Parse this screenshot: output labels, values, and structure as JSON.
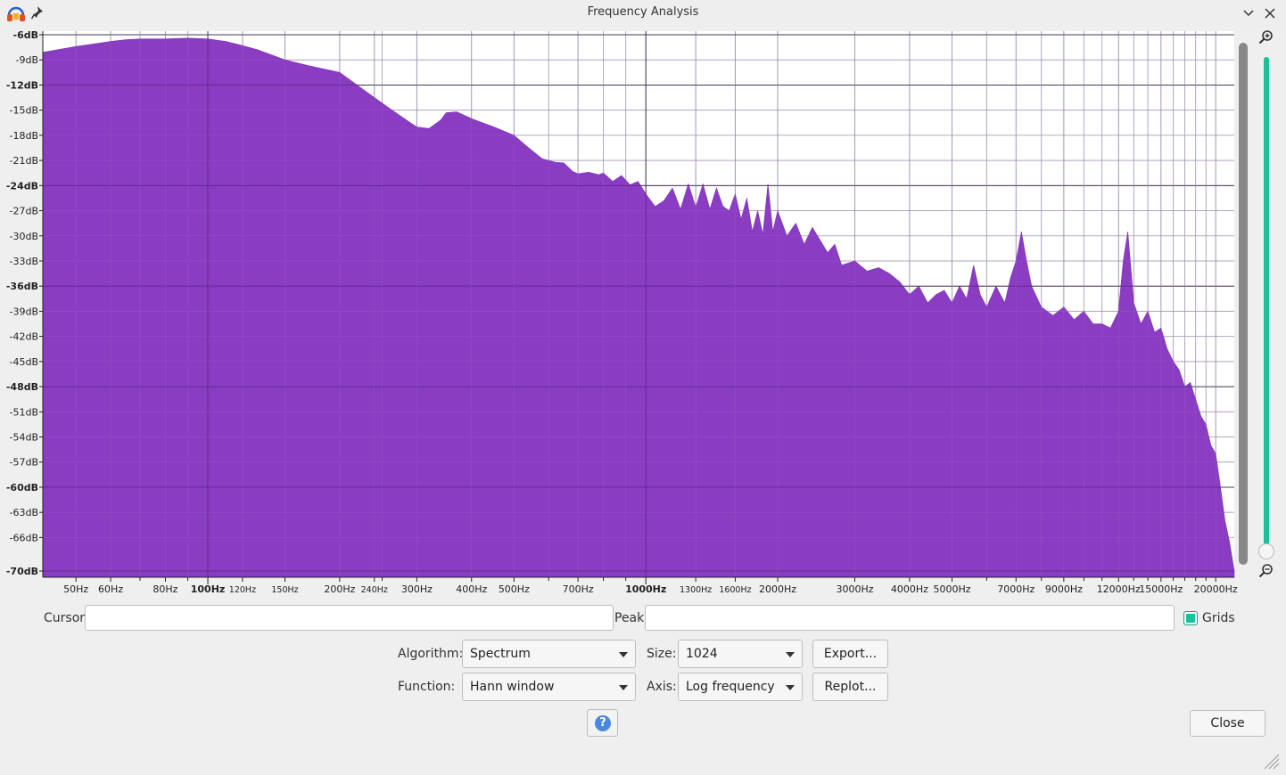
{
  "window": {
    "title": "Frequency Analysis",
    "app_icon": "audacity-headphones-icon",
    "pin_icon": "pin-icon",
    "minimize_icon": "chevron-down-icon",
    "close_icon": "close-icon"
  },
  "chart_data": {
    "type": "area",
    "title": "",
    "xlabel": "",
    "ylabel": "",
    "x_scale": "log",
    "xlim": [
      42,
      22050
    ],
    "ylim": [
      -70,
      -6
    ],
    "grid": true,
    "fill_color": "#8a3dc2",
    "y_ticks": [
      "-6dB",
      "-9dB",
      "-12dB",
      "-15dB",
      "-18dB",
      "-21dB",
      "-24dB",
      "-27dB",
      "-30dB",
      "-33dB",
      "-36dB",
      "-39dB",
      "-42dB",
      "-45dB",
      "-48dB",
      "-51dB",
      "-54dB",
      "-57dB",
      "-60dB",
      "-63dB",
      "-66dB",
      "-70dB"
    ],
    "y_ticks_bold": [
      "-6dB",
      "-12dB",
      "-24dB",
      "-36dB",
      "-48dB",
      "-60dB",
      "-70dB"
    ],
    "x_ticks": [
      "50Hz",
      "60Hz",
      "80Hz",
      "100Hz",
      "120Hz",
      "150Hz",
      "200Hz",
      "240Hz",
      "300Hz",
      "400Hz",
      "500Hz",
      "700Hz",
      "1000Hz",
      "1300Hz",
      "1600Hz",
      "2000Hz",
      "3000Hz",
      "4000Hz",
      "5000Hz",
      "7000Hz",
      "9000Hz",
      "12000Hz",
      "15000Hz",
      "20000Hz"
    ],
    "x_tick_freqs": [
      50,
      60,
      80,
      100,
      120,
      150,
      200,
      240,
      300,
      400,
      500,
      700,
      1000,
      1300,
      1600,
      2000,
      3000,
      4000,
      5000,
      7000,
      9000,
      12000,
      15000,
      20000
    ],
    "x_ticks_bold": [
      "100Hz",
      "1000Hz"
    ],
    "x": [
      42,
      50,
      60,
      65,
      70,
      80,
      90,
      100,
      110,
      120,
      130,
      150,
      170,
      200,
      230,
      260,
      290,
      300,
      320,
      340,
      350,
      370,
      400,
      450,
      500,
      540,
      580,
      620,
      650,
      680,
      700,
      740,
      780,
      800,
      840,
      880,
      920,
      960,
      1000,
      1050,
      1100,
      1150,
      1200,
      1250,
      1300,
      1350,
      1400,
      1450,
      1500,
      1550,
      1600,
      1650,
      1700,
      1750,
      1800,
      1850,
      1900,
      1950,
      2000,
      2100,
      2200,
      2300,
      2400,
      2500,
      2600,
      2700,
      2800,
      3000,
      3200,
      3400,
      3600,
      3800,
      4000,
      4200,
      4400,
      4600,
      4800,
      5000,
      5200,
      5400,
      5600,
      5800,
      6000,
      6300,
      6600,
      6800,
      7000,
      7200,
      7400,
      7600,
      8000,
      8500,
      9000,
      9500,
      10000,
      10500,
      11000,
      11500,
      12000,
      12300,
      12600,
      13000,
      13500,
      14000,
      14500,
      15000,
      15500,
      16000,
      16500,
      17000,
      17500,
      18000,
      18500,
      19000,
      19500,
      20000,
      20500,
      21000,
      21500,
      22050
    ],
    "y": [
      -8.1,
      -7.4,
      -6.8,
      -6.6,
      -6.5,
      -6.5,
      -6.4,
      -6.5,
      -6.8,
      -7.3,
      -7.8,
      -9,
      -9.7,
      -10.5,
      -12.8,
      -14.8,
      -16.5,
      -17,
      -17.2,
      -16.2,
      -15.3,
      -15.2,
      -16,
      -17,
      -18,
      -19.5,
      -20.8,
      -21.2,
      -21.3,
      -22.3,
      -22.6,
      -22.4,
      -22.7,
      -22.5,
      -23.5,
      -22.8,
      -23.9,
      -23.5,
      -25,
      -26.5,
      -25.8,
      -24.3,
      -26.8,
      -23.8,
      -26.6,
      -23.8,
      -26.8,
      -24.3,
      -26.5,
      -27,
      -25,
      -28,
      -25.5,
      -29.5,
      -27,
      -29.8,
      -23.8,
      -29.5,
      -27,
      -30,
      -28.5,
      -31,
      -29,
      -30.5,
      -32,
      -31,
      -33.5,
      -33,
      -34.2,
      -33.8,
      -34.5,
      -35.5,
      -37,
      -36,
      -38,
      -37,
      -36.5,
      -38,
      -36,
      -37.5,
      -33.5,
      -37,
      -38.5,
      -36,
      -38,
      -35,
      -33,
      -29.5,
      -33,
      -36,
      -38.5,
      -39.5,
      -38.5,
      -40,
      -39,
      -40.5,
      -40.5,
      -41,
      -39,
      -33,
      -29.5,
      -38,
      -40.5,
      -39,
      -41.5,
      -41,
      -43.5,
      -45,
      -46,
      -48,
      -47.5,
      -49.5,
      -51.5,
      -52.5,
      -55,
      -56,
      -60,
      -64,
      -66.5,
      -70
    ]
  },
  "controls": {
    "cursor_label": "Cursor:",
    "cursor_value": "",
    "peak_label": "Peak:",
    "peak_value": "",
    "grids_label": "Grids",
    "grids_checked": true,
    "algorithm_label": "Algorithm:",
    "algorithm_value": "Spectrum",
    "size_label": "Size:",
    "size_value": "1024",
    "function_label": "Function:",
    "function_value": "Hann window",
    "axis_label": "Axis:",
    "axis_value": "Log frequency",
    "export_label": "Export...",
    "replot_label": "Replot...",
    "help_label": "?",
    "close_label": "Close"
  }
}
